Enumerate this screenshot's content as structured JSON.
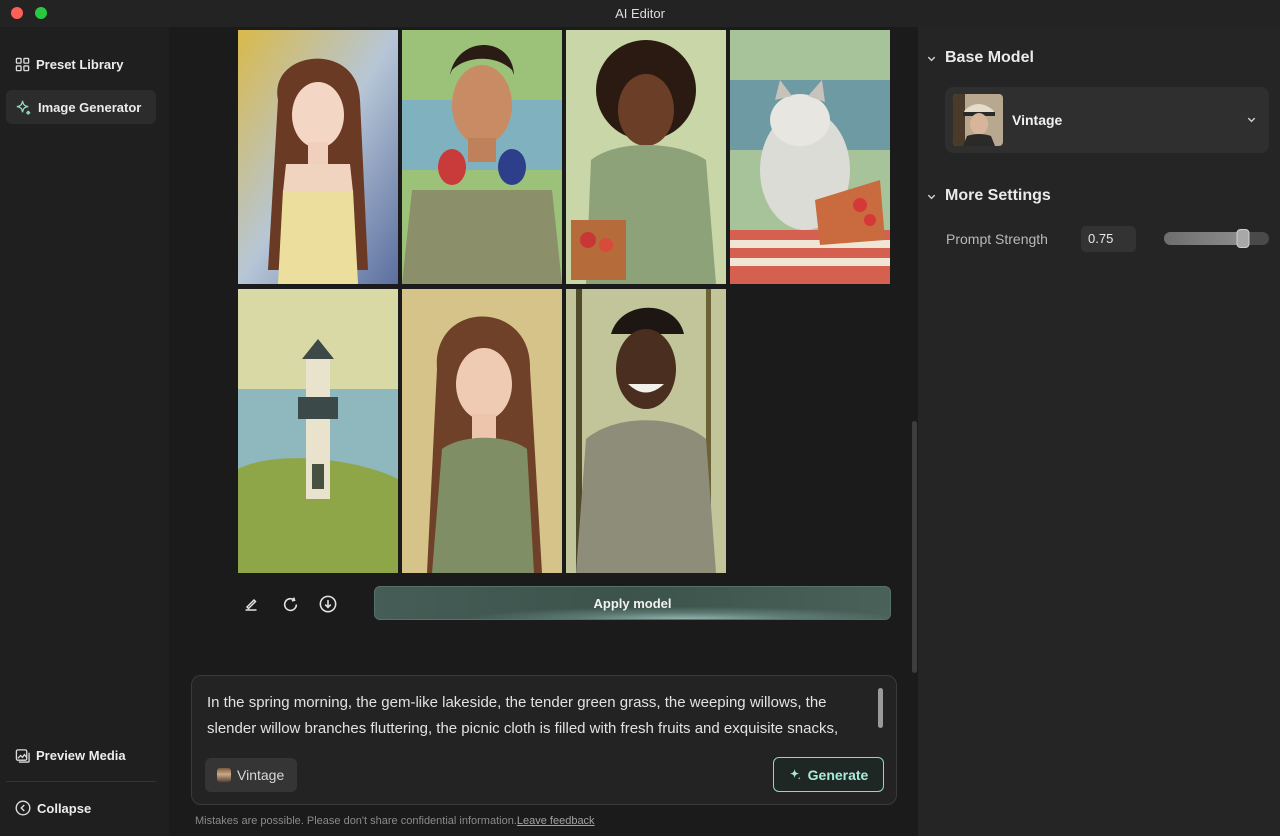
{
  "window": {
    "title": "AI Editor"
  },
  "sidebar": {
    "items": [
      {
        "label": "Preset Library",
        "icon": "grid-icon"
      },
      {
        "label": "Image Generator",
        "icon": "sparkle-icon",
        "active": true
      }
    ],
    "bottom_items": [
      {
        "label": "Preview Media",
        "icon": "media-icon"
      },
      {
        "label": "Collapse",
        "icon": "chevron-left-circle-icon"
      }
    ]
  },
  "gallery": {
    "images": [
      "girl-long-hair-yellow-dress",
      "young-man-headphones-lake",
      "woman-curly-hair-picnic-basket",
      "cat-picnic-fruits",
      "lighthouse-lake-willow",
      "woman-green-tank-top",
      "smiling-man-willows"
    ]
  },
  "toolbar": {
    "icons": [
      "edit-icon",
      "refresh-icon",
      "download-icon"
    ],
    "apply_label": "Apply model"
  },
  "prompt": {
    "text": "In the spring morning, the gem-like lakeside, the tender green grass, the weeping willows, the slender willow branches fluttering, the picnic cloth is filled with fresh fruits and exquisite snacks,",
    "model_chip": "Vintage",
    "generate_label": "Generate"
  },
  "footer": {
    "disclaimer": "Mistakes are possible. Please don't share confidential information.",
    "feedback_link": "Leave feedback"
  },
  "settings": {
    "base_model_heading": "Base Model",
    "base_model_value": "Vintage",
    "more_settings_heading": "More Settings",
    "prompt_strength_label": "Prompt Strength",
    "prompt_strength_value": "0.75",
    "prompt_strength_level": 0.75
  },
  "colors": {
    "accent_generate": "#8fd8c4",
    "apply_button": "#455d56"
  }
}
